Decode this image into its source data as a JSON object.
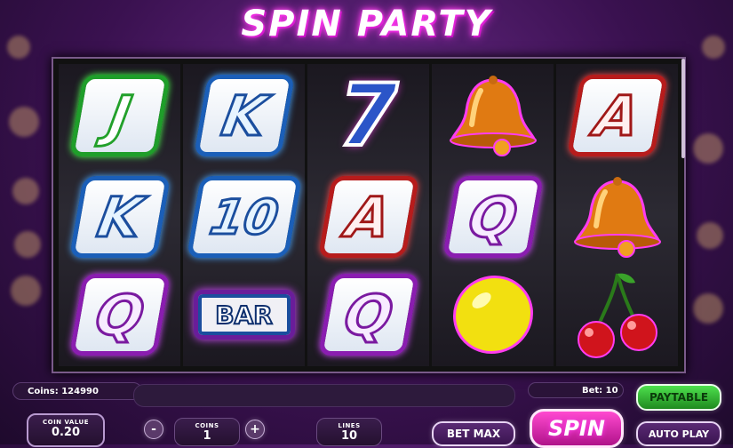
{
  "title": "SPIN PARTY",
  "reels": [
    [
      "J",
      "K",
      "Q"
    ],
    [
      "K",
      "10",
      "BAR"
    ],
    [
      "7",
      "A",
      "Q"
    ],
    [
      "bell",
      "Q",
      "lemon"
    ],
    [
      "A",
      "bell",
      "cherries"
    ]
  ],
  "status": {
    "coins_label": "Coins: 124990",
    "bet_label": "Bet: 10"
  },
  "controls": {
    "paytable": "PAYTABLE",
    "coin_value_label": "COIN VALUE",
    "coin_value": "0.20",
    "minus": "-",
    "plus": "+",
    "coins_label": "COINS",
    "coins": "1",
    "lines_label": "LINES",
    "lines": "10",
    "bet_max": "BET MAX",
    "spin": "SPIN",
    "auto_play": "AUTO PLAY"
  },
  "colors": {
    "accent_pink": "#ff3cf0",
    "paytable_green": "#2faa2f"
  }
}
